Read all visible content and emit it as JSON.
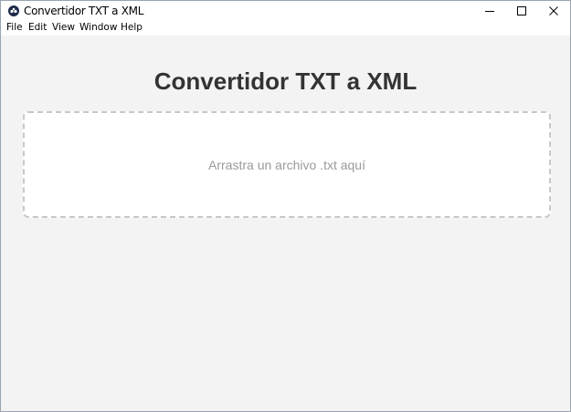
{
  "window": {
    "title": "Convertidor TXT a XML",
    "app_icon": "app-logo-icon",
    "controls": [
      "minimize-icon",
      "maximize-icon",
      "close-icon"
    ]
  },
  "menu": {
    "file": "File",
    "edit": "Edit",
    "view": "View",
    "window": "Window",
    "help": "Help"
  },
  "main": {
    "heading": "Convertidor TXT a XML",
    "dropzone_text": "Arrastra un archivo .txt aquí"
  },
  "colors": {
    "background": "#f3f3f3",
    "heading": "#333333",
    "dropzone_border": "#c8c8c8",
    "dropzone_text": "#9a9a9a"
  }
}
